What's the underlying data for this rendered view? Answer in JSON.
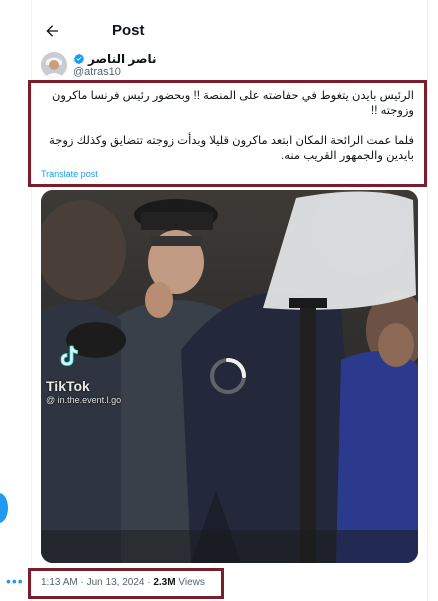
{
  "header": {
    "title": "Post"
  },
  "author": {
    "name": "ناصر الناصر",
    "handle": "@atras10"
  },
  "tweet": {
    "paragraphs": [
      "الرئيس بايدن يتغوط في حفاضته على المنصة !! وبحضور رئيس فرنسا ماكرون وزوجته !!",
      "فلما عمت الرائحة المكان ابتعد ماكرون قليلا وبدأت زوجته تتضايق وكذلك زوجة بايدين والجمهور القريب منه."
    ],
    "translate_label": "Translate post"
  },
  "media": {
    "watermark_name": "TikTok",
    "watermark_handle": "@ in.the.event.l.go"
  },
  "meta": {
    "time": "1:13 AM",
    "separator": "·",
    "date": "Jun 13, 2024",
    "views_count": "2.3M",
    "views_label": "Views"
  },
  "colors": {
    "accent": "#1d9bf0",
    "highlight_border": "#7a1e2b",
    "secondary_text": "#536471"
  }
}
